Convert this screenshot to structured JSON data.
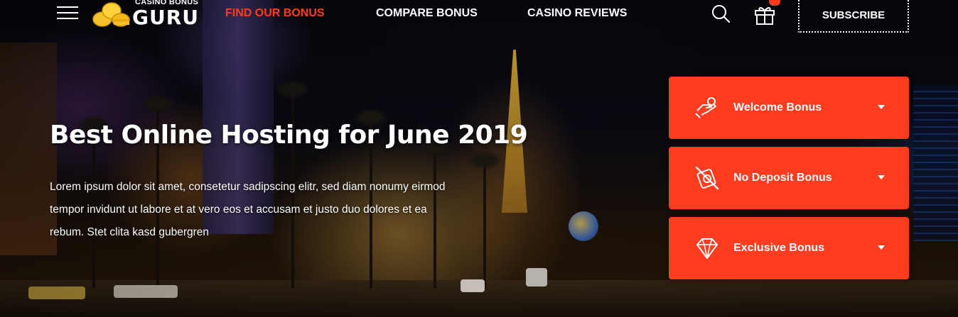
{
  "nav": {
    "menu_icon": "hamburger-menu-icon",
    "logo": {
      "small_text": "CASINO BONUS",
      "big_text": "GURU",
      "icon": "gold-coins-icon"
    },
    "links": [
      {
        "label": "FIND OUR BONUS",
        "active": true
      },
      {
        "label": "COMPARE BONUS",
        "active": false
      },
      {
        "label": "CASINO REVIEWS",
        "active": false
      }
    ],
    "search_icon": "search-icon",
    "gift_icon": "gift-icon",
    "subscribe_label": "SUBSCRIBE",
    "accent_color": "#ff3c1f"
  },
  "hero": {
    "title": "Best Online Hosting for June 2019",
    "body": "Lorem ipsum dolor sit amet, consetetur sadipscing elitr, sed diam nonumy eirmod tempor invidunt ut labore et at vero eos et accusam et justo duo dolores et ea rebum. Stet clita kasd gubergren"
  },
  "bonuses": [
    {
      "label": "Welcome Bonus",
      "icon": "hand-coin-icon"
    },
    {
      "label": "No Deposit Bonus",
      "icon": "no-deposit-icon"
    },
    {
      "label": "Exclusive Bonus",
      "icon": "diamond-icon"
    }
  ]
}
